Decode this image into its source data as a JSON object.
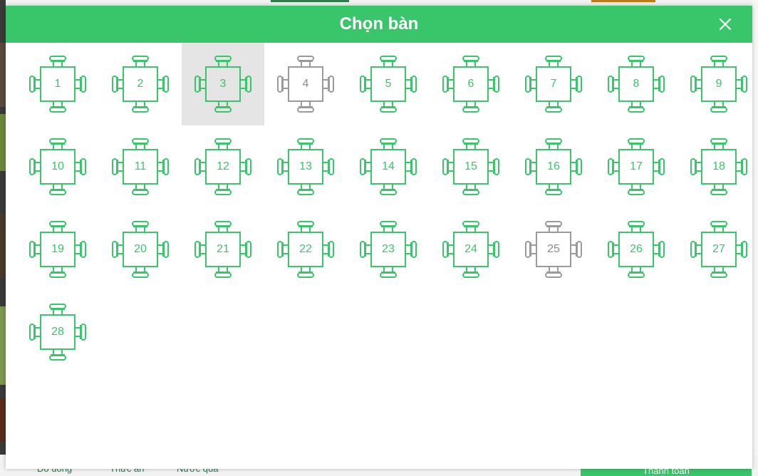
{
  "modal": {
    "title": "Chọn bàn",
    "close_icon": "close-icon"
  },
  "colors": {
    "accent": "#39c56a",
    "busy": "#9a9a9a",
    "selected_bg": "#e5e5e5"
  },
  "tables": [
    {
      "label": "1",
      "status": "free"
    },
    {
      "label": "2",
      "status": "free"
    },
    {
      "label": "3",
      "status": "selected"
    },
    {
      "label": "4",
      "status": "busy"
    },
    {
      "label": "5",
      "status": "free"
    },
    {
      "label": "6",
      "status": "free"
    },
    {
      "label": "7",
      "status": "free"
    },
    {
      "label": "8",
      "status": "free"
    },
    {
      "label": "9",
      "status": "free"
    },
    {
      "label": "10",
      "status": "free"
    },
    {
      "label": "11",
      "status": "free"
    },
    {
      "label": "12",
      "status": "free"
    },
    {
      "label": "13",
      "status": "free"
    },
    {
      "label": "14",
      "status": "free"
    },
    {
      "label": "15",
      "status": "free"
    },
    {
      "label": "16",
      "status": "free"
    },
    {
      "label": "17",
      "status": "free"
    },
    {
      "label": "18",
      "status": "free"
    },
    {
      "label": "19",
      "status": "free"
    },
    {
      "label": "20",
      "status": "free"
    },
    {
      "label": "21",
      "status": "free"
    },
    {
      "label": "22",
      "status": "free"
    },
    {
      "label": "23",
      "status": "free"
    },
    {
      "label": "24",
      "status": "free"
    },
    {
      "label": "25",
      "status": "busy"
    },
    {
      "label": "26",
      "status": "free"
    },
    {
      "label": "27",
      "status": "free"
    },
    {
      "label": "28",
      "status": "free"
    }
  ],
  "background": {
    "tabs": [
      "Đồ uống",
      "Thức ăn",
      "Nước quả"
    ],
    "pay_button": "Thanh toán"
  }
}
